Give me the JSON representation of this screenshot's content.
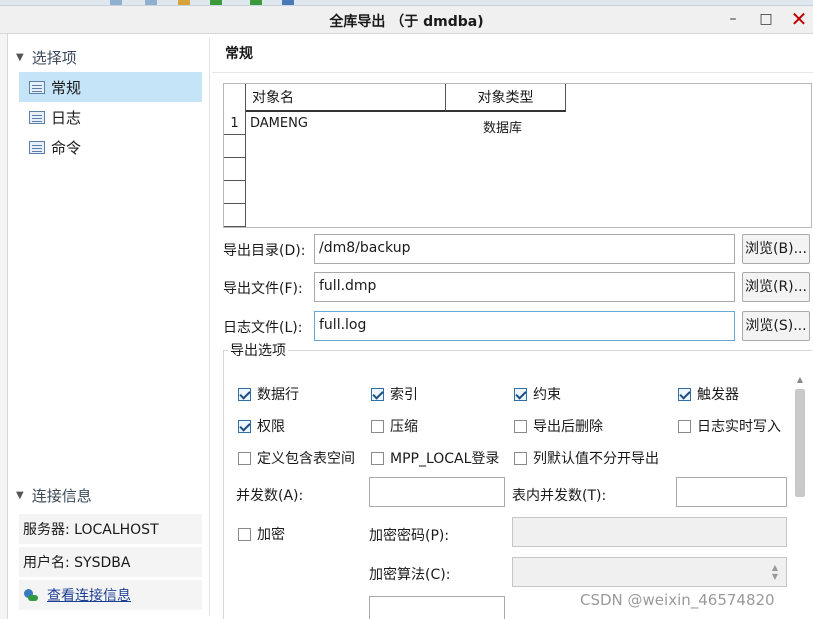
{
  "window": {
    "title": "全库导出 （于 dmdba)",
    "minimize_glyph": "–",
    "maximize_glyph": "□",
    "close_glyph": "✕"
  },
  "left": {
    "options_header": "选择项",
    "nav_items": [
      {
        "label": "常规",
        "icon": "table-icon",
        "active": true
      },
      {
        "label": "日志",
        "icon": "table-icon",
        "active": false
      },
      {
        "label": "命令",
        "icon": "table-icon",
        "active": false
      }
    ],
    "conn_header": "连接信息",
    "server": "服务器: LOCALHOST",
    "user": "用户名: SYSDBA",
    "view_conn_link": "查看连接信息"
  },
  "main": {
    "section_title": "常规",
    "grid": {
      "columns": [
        "对象名",
        "对象类型"
      ],
      "rows": [
        {
          "num": "1",
          "name": "DAMENG",
          "type": "数据库"
        }
      ]
    },
    "export_dir_label": "导出目录(D):",
    "export_dir_value": "/dm8/backup",
    "browse_b": "浏览(B)...",
    "export_file_label": "导出文件(F):",
    "export_file_value": "full.dmp",
    "browse_r": "浏览(R)...",
    "log_file_label": "日志文件(L):",
    "log_file_value": "full.log",
    "browse_s": "浏览(S)...",
    "options_group_label": "导出选项",
    "checkboxes": {
      "data_rows": {
        "label": "数据行",
        "checked": true
      },
      "index": {
        "label": "索引",
        "checked": true
      },
      "constraint": {
        "label": "约束",
        "checked": true
      },
      "trigger": {
        "label": "触发器",
        "checked": true
      },
      "privilege": {
        "label": "权限",
        "checked": true
      },
      "compress": {
        "label": "压缩",
        "checked": false
      },
      "delete_after": {
        "label": "导出后删除",
        "checked": false
      },
      "log_realtime": {
        "label": "日志实时写入",
        "checked": false
      },
      "define_tablespace": {
        "label": "定义包含表空间",
        "checked": false
      },
      "mpp_local": {
        "label": "MPP_LOCAL登录",
        "checked": false
      },
      "col_default": {
        "label": "列默认值不分开导出",
        "checked": false
      },
      "encrypt": {
        "label": "加密",
        "checked": false
      }
    },
    "parallel_label": "并发数(A):",
    "table_parallel_label": "表内并发数(T):",
    "encrypt_pwd_label": "加密密码(P):",
    "encrypt_algo_label": "加密算法(C):"
  },
  "watermark": "CSDN @weixin_46574820"
}
